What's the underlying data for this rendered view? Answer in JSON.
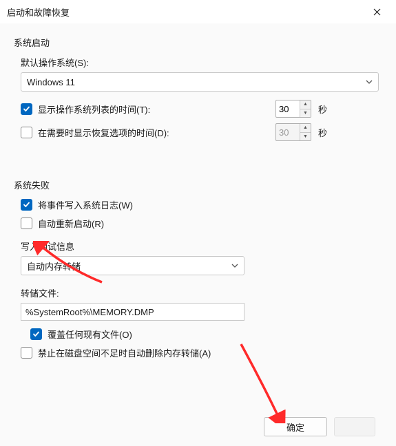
{
  "title": "启动和故障恢复",
  "startup": {
    "heading": "系统启动",
    "default_os_label": "默认操作系统(S):",
    "default_os_value": "Windows 11",
    "show_os_list_label": "显示操作系统列表的时间(T):",
    "show_os_list_checked": true,
    "show_os_list_seconds": "30",
    "show_recovery_label": "在需要时显示恢复选项的时间(D):",
    "show_recovery_checked": false,
    "show_recovery_seconds": "30",
    "seconds_unit": "秒"
  },
  "failure": {
    "heading": "系统失败",
    "write_event_label": "将事件写入系统日志(W)",
    "write_event_checked": true,
    "auto_restart_label": "自动重新启动(R)",
    "auto_restart_checked": false,
    "debug_section_label": "写入调试信息",
    "debug_select_value": "自动内存转储",
    "dump_file_label": "转储文件:",
    "dump_file_value": "%SystemRoot%\\MEMORY.DMP",
    "overwrite_label": "覆盖任何现有文件(O)",
    "overwrite_checked": true,
    "no_delete_low_label": "禁止在磁盘空间不足时自动删除内存转储(A)",
    "no_delete_low_checked": false
  },
  "buttons": {
    "ok": "确定"
  },
  "colors": {
    "accent": "#0067c0",
    "arrow": "#ff2a2a"
  }
}
